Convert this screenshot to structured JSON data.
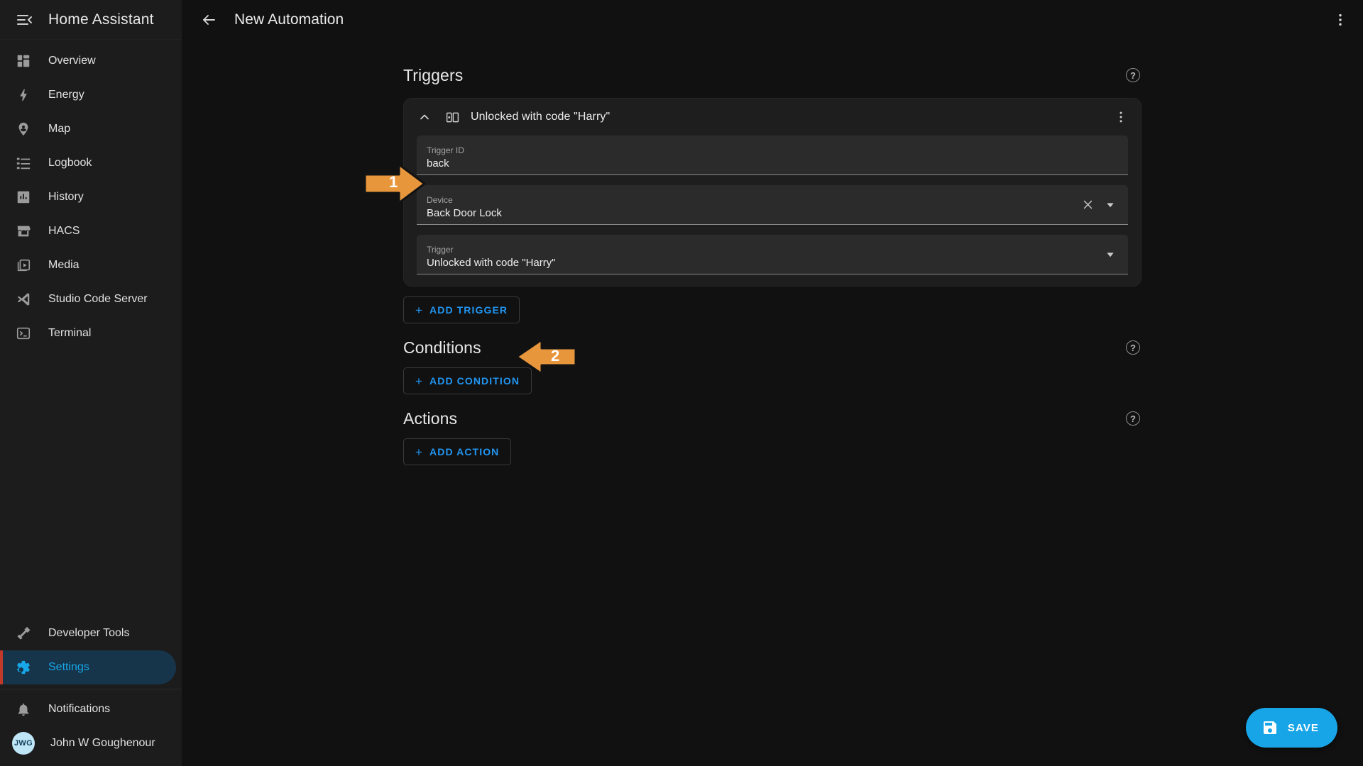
{
  "sidebar": {
    "title": "Home Assistant",
    "toggle_icon": "menu-collapse-icon",
    "items": [
      {
        "label": "Overview",
        "icon": "view-dashboard-icon"
      },
      {
        "label": "Energy",
        "icon": "lightning-bolt-icon"
      },
      {
        "label": "Map",
        "icon": "map-marker-account-icon"
      },
      {
        "label": "Logbook",
        "icon": "format-list-icon"
      },
      {
        "label": "History",
        "icon": "chart-box-icon"
      },
      {
        "label": "HACS",
        "icon": "store-icon"
      },
      {
        "label": "Media",
        "icon": "play-box-multiple-icon"
      },
      {
        "label": "Studio Code Server",
        "icon": "vscode-icon"
      },
      {
        "label": "Terminal",
        "icon": "console-icon"
      }
    ],
    "bottom_items": [
      {
        "label": "Developer Tools",
        "icon": "hammer-icon"
      },
      {
        "label": "Settings",
        "icon": "cog-icon",
        "active": true
      }
    ],
    "footer_items": [
      {
        "label": "Notifications",
        "icon": "bell-icon"
      }
    ],
    "user": {
      "name": "John W Goughenour",
      "initials": "JWG"
    },
    "active_color": "#17a7e8"
  },
  "topbar": {
    "back_icon": "arrow-left-icon",
    "title": "New Automation",
    "overflow_icon": "dots-vertical-icon"
  },
  "sections": {
    "triggers": {
      "title": "Triggers",
      "help_label": "?"
    },
    "conditions": {
      "title": "Conditions",
      "help_label": "?"
    },
    "actions": {
      "title": "Actions",
      "help_label": "?"
    }
  },
  "trigger_card": {
    "title": "Unlocked with code \"Harry\"",
    "collapse_icon": "chevron-up-icon",
    "type_icon": "device-trigger-icon",
    "overflow_icon": "dots-vertical-icon",
    "fields": [
      {
        "label": "Trigger ID",
        "value": "back",
        "has_clear": false,
        "has_dropdown": false
      },
      {
        "label": "Device",
        "value": "Back Door Lock",
        "has_clear": true,
        "has_dropdown": true
      },
      {
        "label": "Trigger",
        "value": "Unlocked with code \"Harry\"",
        "has_clear": false,
        "has_dropdown": true
      }
    ]
  },
  "buttons": {
    "add_trigger": "ADD TRIGGER",
    "add_condition": "ADD CONDITION",
    "add_action": "ADD ACTION",
    "plus": "+",
    "save": "SAVE",
    "save_icon": "content-save-icon"
  },
  "annotations": [
    {
      "number": "1",
      "direction": "right",
      "target": "trigger-id-field"
    },
    {
      "number": "2",
      "direction": "left",
      "target": "add-trigger-button"
    }
  ],
  "colors": {
    "accent_blue": "#2196f3",
    "save_blue": "#18a5e8",
    "annotation_orange": "#e8963c",
    "active_nav": "#16344a",
    "page_bg": "#111111",
    "sidebar_bg": "#1c1c1c",
    "card_bg": "#1e1e1e",
    "field_bg": "#2b2b2b"
  }
}
